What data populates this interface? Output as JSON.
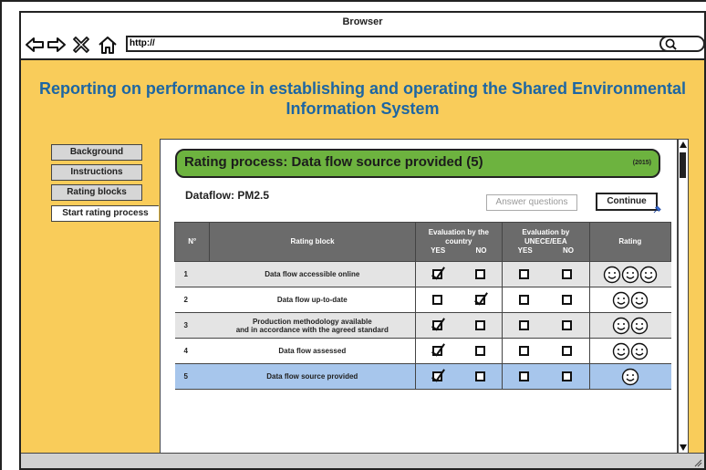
{
  "browser": {
    "title": "Browser",
    "url": "http://"
  },
  "page": {
    "heading_line1": "Reporting on performance in establishing and operating the Shared Environmental",
    "heading_line2": "Information System"
  },
  "left_nav": [
    {
      "label": "Background",
      "active": false
    },
    {
      "label": "Instructions",
      "active": false
    },
    {
      "label": "Rating blocks",
      "active": false
    },
    {
      "label": "Start rating process",
      "active": true
    }
  ],
  "panel": {
    "title": "Rating process: Data flow source provided (5)",
    "year": "(2015)",
    "dataflow": "Dataflow: PM2.5",
    "answer_button": "Answer questions",
    "continue_button": "Continue"
  },
  "table": {
    "headers": {
      "num": "N°",
      "block": "Rating block",
      "eval_country": "Evaluation by the country",
      "eval_unece": "Evaluation by UNECE/EEA",
      "yes": "YES",
      "no": "NO",
      "rating": "Rating"
    },
    "rows": [
      {
        "num": "1",
        "block": "Data flow accessible online",
        "country_yes": true,
        "country_no": false,
        "unece_yes": false,
        "unece_no": false,
        "rating": 3
      },
      {
        "num": "2",
        "block": "Data flow up-to-date",
        "country_yes": false,
        "country_no": true,
        "unece_yes": false,
        "unece_no": false,
        "rating": 2
      },
      {
        "num": "3",
        "block": "Production methodology available and in accordance with the agreed standard",
        "block_line1": "Production methodology available",
        "block_line2": "and in accordance with the agreed standard",
        "country_yes": true,
        "country_no": false,
        "unece_yes": false,
        "unece_no": false,
        "rating": 2
      },
      {
        "num": "4",
        "block": "Data flow assessed",
        "country_yes": true,
        "country_no": false,
        "unece_yes": false,
        "unece_no": false,
        "rating": 2
      },
      {
        "num": "5",
        "block": "Data flow source provided",
        "country_yes": true,
        "country_no": false,
        "unece_yes": false,
        "unece_no": false,
        "rating": 1
      }
    ]
  },
  "colors": {
    "background": "#f9cc5a",
    "heading": "#1d66a3",
    "banner": "#6db33f",
    "header_fill": "#6b6b6b",
    "selected_row": "#a7c6ec"
  }
}
